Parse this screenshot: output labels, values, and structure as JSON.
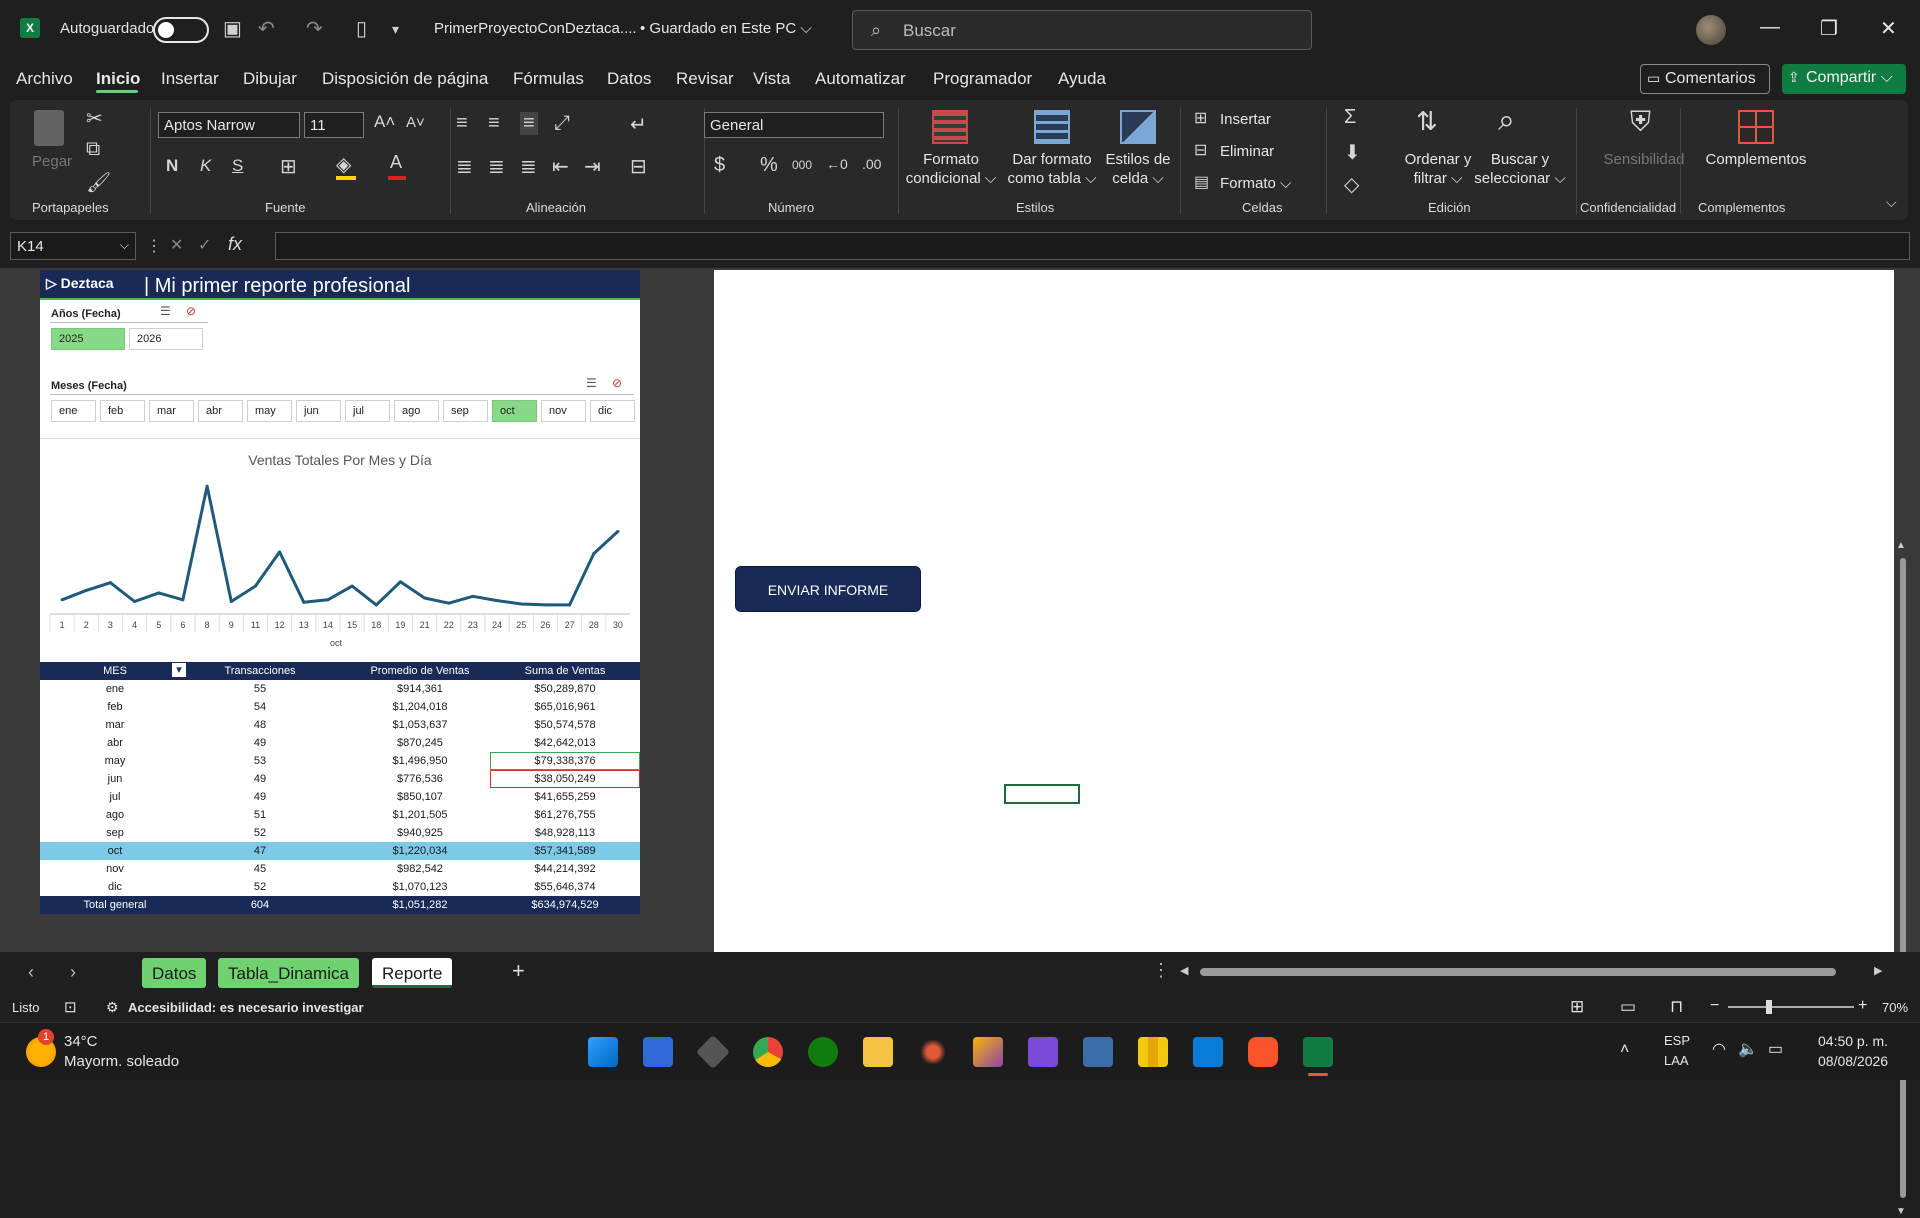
{
  "titlebar": {
    "autosave_label": "Autoguardado",
    "filename": "PrimerProyectoConDeztaca....",
    "saved_status": "• Guardado en Este PC ⌵",
    "search_placeholder": "Buscar",
    "minimize": "—",
    "restore": "❐",
    "close": "✕"
  },
  "menu": {
    "items": [
      "Archivo",
      "Inicio",
      "Insertar",
      "Dibujar",
      "Disposición de página",
      "Fórmulas",
      "Datos",
      "Revisar",
      "Vista",
      "Automatizar",
      "Programador",
      "Ayuda"
    ],
    "comments": "Comentarios",
    "share": "Compartir ⌵"
  },
  "ribbon": {
    "paste": "Pegar",
    "groups": {
      "clipboard": "Portapapeles",
      "font": "Fuente",
      "alignment": "Alineación",
      "number": "Número",
      "styles": "Estilos",
      "cells": "Celdas",
      "editing": "Edición",
      "confidentiality": "Confidencialidad",
      "addins": "Complementos"
    },
    "font_name": "Aptos Narrow",
    "font_size": "11",
    "number_format": "General",
    "conditional_format": [
      "Formato",
      "condicional ⌵"
    ],
    "format_table": [
      "Dar formato",
      "como tabla ⌵"
    ],
    "cell_styles": [
      "Estilos de",
      "celda ⌵"
    ],
    "insert": "Insertar",
    "delete": "Eliminar",
    "format": "Formato ⌵",
    "sort_filter": [
      "Ordenar y",
      "filtrar ⌵"
    ],
    "find_select": [
      "Buscar y",
      "seleccionar ⌵"
    ],
    "sensitivity": "Sensibilidad",
    "addins_btn": "Complementos"
  },
  "formula_bar": {
    "name_box": "K14",
    "fx": "fx"
  },
  "report": {
    "logo": "Deztaca",
    "title": "| Mi primer reporte profesional",
    "years_slicer_title": "Años (Fecha)",
    "years": [
      {
        "label": "2025",
        "selected": true
      },
      {
        "label": "2026",
        "selected": false
      }
    ],
    "months_slicer_title": "Meses (Fecha)",
    "months": [
      {
        "label": "ene",
        "selected": false
      },
      {
        "label": "feb",
        "selected": false
      },
      {
        "label": "mar",
        "selected": false
      },
      {
        "label": "abr",
        "selected": false
      },
      {
        "label": "may",
        "selected": false
      },
      {
        "label": "jun",
        "selected": false
      },
      {
        "label": "jul",
        "selected": false
      },
      {
        "label": "ago",
        "selected": false
      },
      {
        "label": "sep",
        "selected": false
      },
      {
        "label": "oct",
        "selected": true
      },
      {
        "label": "nov",
        "selected": false
      },
      {
        "label": "dic",
        "selected": false
      }
    ],
    "table": {
      "headers": [
        "MES",
        "Transacciones",
        "Promedio de Ventas",
        "Suma de Ventas"
      ],
      "rows": [
        [
          "ene",
          "55",
          "$914,361",
          "$50,289,870"
        ],
        [
          "feb",
          "54",
          "$1,204,018",
          "$65,016,961"
        ],
        [
          "mar",
          "48",
          "$1,053,637",
          "$50,574,578"
        ],
        [
          "abr",
          "49",
          "$870,245",
          "$42,642,013"
        ],
        [
          "may",
          "53",
          "$1,496,950",
          "$79,338,376"
        ],
        [
          "jun",
          "49",
          "$776,536",
          "$38,050,249"
        ],
        [
          "jul",
          "49",
          "$850,107",
          "$41,655,259"
        ],
        [
          "ago",
          "51",
          "$1,201,505",
          "$61,276,755"
        ],
        [
          "sep",
          "52",
          "$940,925",
          "$48,928,113"
        ],
        [
          "oct",
          "47",
          "$1,220,034",
          "$57,341,589"
        ],
        [
          "nov",
          "45",
          "$982,542",
          "$44,214,392"
        ],
        [
          "dic",
          "52",
          "$1,070,123",
          "$55,646,374"
        ]
      ],
      "total": [
        "Total general",
        "604",
        "$1,051,282",
        "$634,974,529"
      ],
      "highlight_row": "oct",
      "max_row": "may",
      "min_row": "jun"
    },
    "send_button": "ENVIAR INFORME"
  },
  "chart_data": {
    "type": "line",
    "title": "Ventas Totales Por Mes y Día",
    "x": [
      "1",
      "2",
      "3",
      "4",
      "5",
      "6",
      "8",
      "9",
      "11",
      "12",
      "13",
      "14",
      "15",
      "18",
      "19",
      "21",
      "22",
      "23",
      "24",
      "25",
      "26",
      "27",
      "28",
      "30"
    ],
    "xlabel": "oct",
    "series": [
      {
        "values": [
          1.2,
          2.3,
          3.2,
          1.0,
          2.0,
          1.2,
          14.5,
          1.0,
          2.8,
          6.8,
          0.9,
          1.2,
          2.8,
          0.6,
          3.3,
          1.4,
          0.8,
          1.6,
          1.1,
          0.7,
          0.6,
          0.6,
          6.6,
          9.2
        ]
      }
    ],
    "color": "#1e5a7a",
    "grid": false,
    "legend": "none"
  },
  "sheets": {
    "tabs": [
      {
        "label": "Datos",
        "style": "green"
      },
      {
        "label": "Tabla_Dinamica",
        "style": "green"
      },
      {
        "label": "Reporte",
        "style": "active"
      }
    ],
    "add": "+"
  },
  "status": {
    "ready": "Listo",
    "accessibility": "Accesibilidad: es necesario investigar",
    "zoom": "70%"
  },
  "taskbar": {
    "temperature": "34°C",
    "weather": "Mayorm. soleado",
    "weather_badge": "1",
    "lang1": "ESP",
    "lang2": "LAA",
    "time": "04:50 p. m.",
    "date": "08/08/2026"
  }
}
